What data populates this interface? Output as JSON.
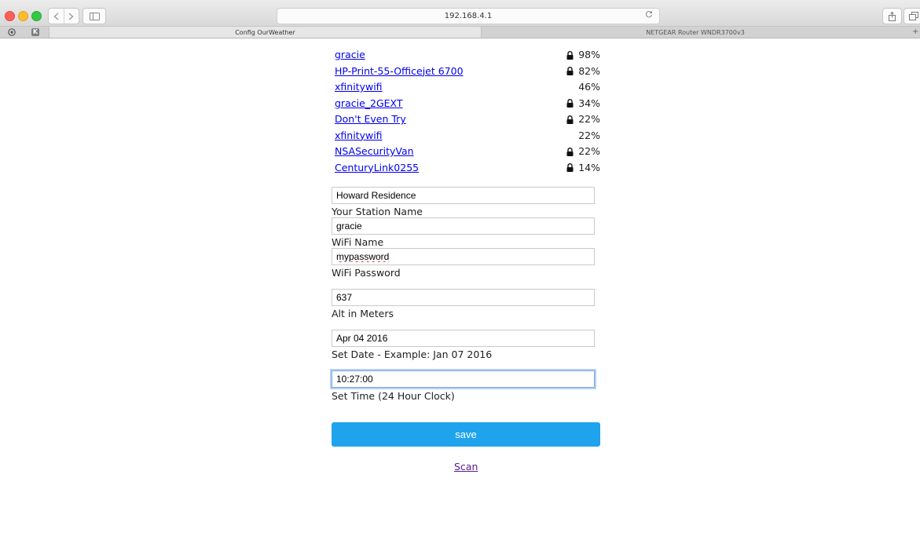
{
  "browser": {
    "url": "192.168.4.1",
    "tabs": [
      {
        "title": "Config OurWeather",
        "active": true
      },
      {
        "title": "NETGEAR Router WNDR3700v3",
        "active": false
      }
    ],
    "icons": {
      "back": "chevron-left",
      "forward": "chevron-right",
      "sidebar": "sidebar-toggle",
      "reload": "reload",
      "share": "share",
      "tabs": "tab-overview",
      "pinned_1": "github",
      "pinned_2": "k"
    },
    "pinned_k_label": "K",
    "add_tab_glyph": "+"
  },
  "networks": [
    {
      "ssid": "gracie",
      "signal": "98%",
      "locked": true
    },
    {
      "ssid": "HP-Print-55-Officejet 6700",
      "signal": "82%",
      "locked": true
    },
    {
      "ssid": "xfinitywifi",
      "signal": "46%",
      "locked": false
    },
    {
      "ssid": "gracie_2GEXT",
      "signal": "34%",
      "locked": true
    },
    {
      "ssid": "Don't Even Try",
      "signal": "22%",
      "locked": true
    },
    {
      "ssid": "xfinitywifi",
      "signal": "22%",
      "locked": false
    },
    {
      "ssid": "NSASecurityVan",
      "signal": "22%",
      "locked": true
    },
    {
      "ssid": "CenturyLink0255",
      "signal": "14%",
      "locked": true
    }
  ],
  "form": {
    "station_name": {
      "value": "Howard Residence",
      "label": "Your Station Name"
    },
    "wifi_name": {
      "value": "gracie",
      "label": "WiFi Name"
    },
    "wifi_password": {
      "value": "mypassword",
      "label": "WiFi Password"
    },
    "altitude": {
      "value": "637",
      "label": "Alt in Meters"
    },
    "date": {
      "value": "Apr 04 2016",
      "label": "Set Date - Example: Jan 07 2016"
    },
    "time": {
      "value": "10:27:00",
      "label": "Set Time (24 Hour Clock)"
    },
    "save_label": "save",
    "scan_label": "Scan"
  },
  "colors": {
    "save_button": "#1fa3ec",
    "link": "#0000ee",
    "visited_link": "#551a8b"
  }
}
